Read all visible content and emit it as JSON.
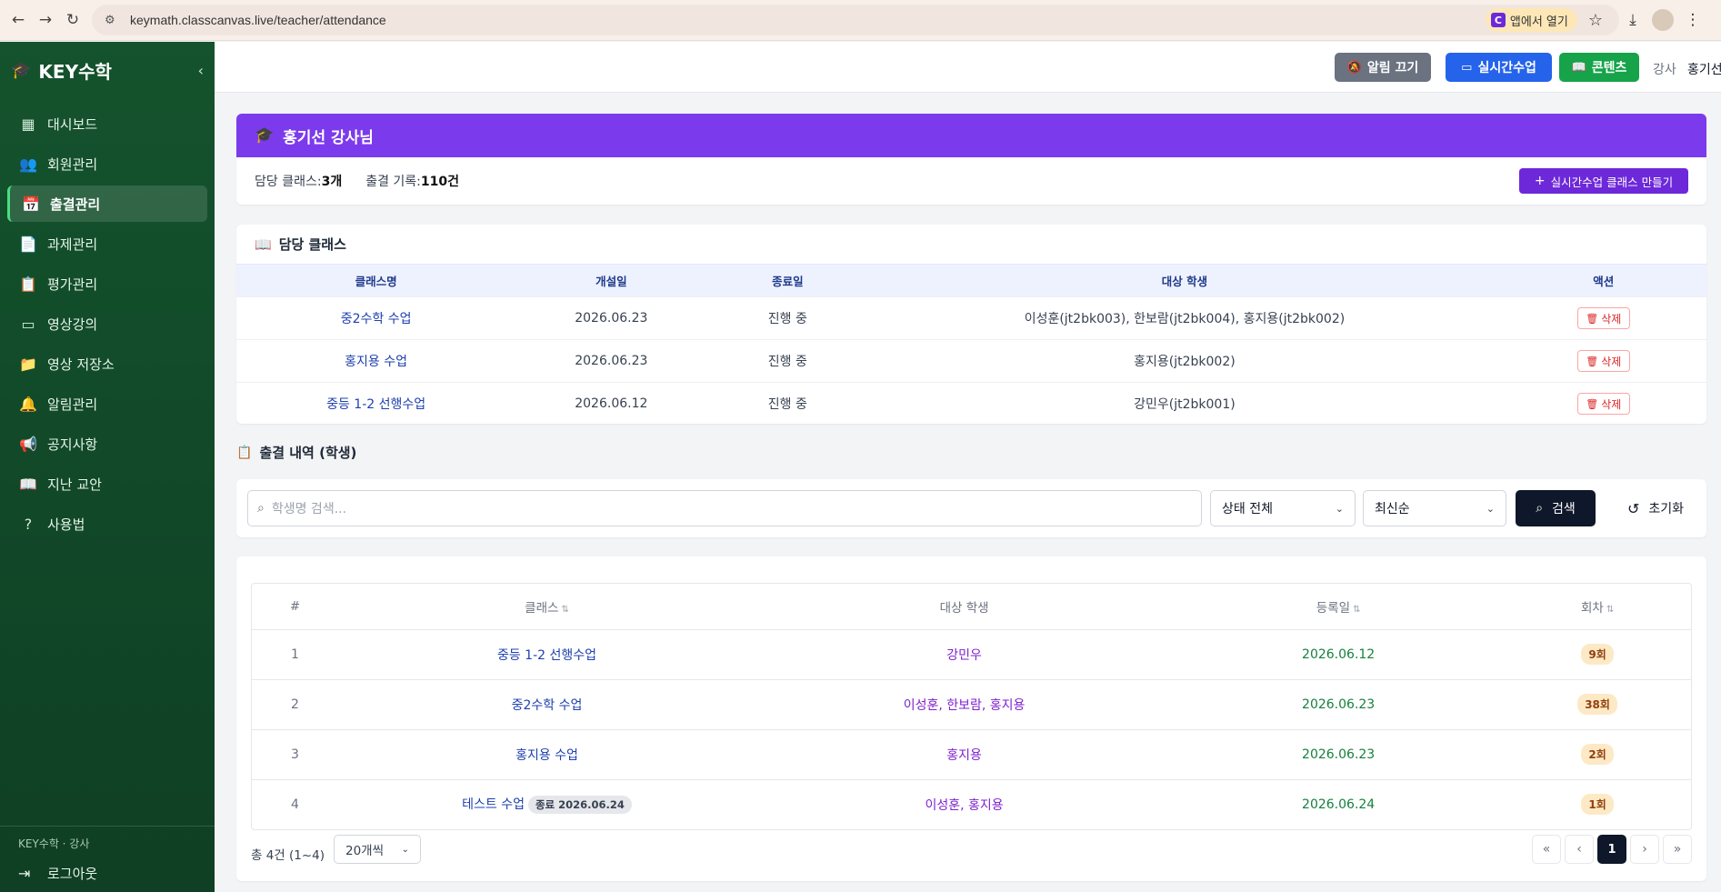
{
  "browser": {
    "url": "keymath.classcanvas.live/teacher/attendance",
    "open_app_label": "앱에서 열기",
    "open_app_icon": "C"
  },
  "sidebar": {
    "brand": "KEY수학",
    "items": [
      {
        "label": "대시보드",
        "icon": "dashboard-icon"
      },
      {
        "label": "회원관리",
        "icon": "users-icon"
      },
      {
        "label": "출결관리",
        "icon": "calendar-check-icon",
        "active": true
      },
      {
        "label": "과제관리",
        "icon": "document-icon"
      },
      {
        "label": "평가관리",
        "icon": "clipboard-icon"
      },
      {
        "label": "영상강의",
        "icon": "video-icon"
      },
      {
        "label": "영상 저장소",
        "icon": "folder-icon"
      },
      {
        "label": "알림관리",
        "icon": "bell-icon"
      },
      {
        "label": "공지사항",
        "icon": "megaphone-icon"
      },
      {
        "label": "지난 교안",
        "icon": "book-icon"
      },
      {
        "label": "사용법",
        "icon": "help-icon"
      }
    ],
    "footer_role": "KEY수학 · 강사",
    "logout_label": "로그아웃"
  },
  "topbar": {
    "mute_label": "알림 끄기",
    "live_label": "실시간수업",
    "content_label": "콘텐츠",
    "role": "강사",
    "name": "홍기선"
  },
  "instructor": {
    "title": "홍기선 강사님",
    "classes_label": "담당 클래스: ",
    "classes_value": "3개",
    "records_label": "출결 기록: ",
    "records_value": "110건",
    "make_class_label": "실시간수업 클래스 만들기"
  },
  "class_section": {
    "title": "담당 클래스",
    "headers": [
      "클래스명",
      "개설일",
      "종료일",
      "대상 학생",
      "액션"
    ],
    "rows": [
      {
        "name": "중2수학 수업",
        "opened": "2026.06.23",
        "ended": "진행 중",
        "students": "이성훈(jt2bk003), 한보람(jt2bk004), 홍지용(jt2bk002)",
        "action": "삭제"
      },
      {
        "name": "홍지용 수업",
        "opened": "2026.06.23",
        "ended": "진행 중",
        "students": "홍지용(jt2bk002)",
        "action": "삭제"
      },
      {
        "name": "중등 1-2 선행수업",
        "opened": "2026.06.12",
        "ended": "진행 중",
        "students": "강민우(jt2bk001)",
        "action": "삭제"
      }
    ]
  },
  "attendance": {
    "title": "출결 내역 (학생)",
    "search_placeholder": "학생명 검색...",
    "status_filter": "상태 전체",
    "sort_filter": "최신순",
    "search_label": "검색",
    "reset_label": "초기화",
    "headers": [
      "#",
      "클래스",
      "대상 학생",
      "등록일",
      "회차"
    ],
    "rows": [
      {
        "no": "1",
        "cls": "중등 1-2 선행수업",
        "badge": "",
        "students": "강민우",
        "date": "2026.06.12",
        "round": "9회"
      },
      {
        "no": "2",
        "cls": "중2수학 수업",
        "badge": "",
        "students": "이성훈, 한보람, 홍지용",
        "date": "2026.06.23",
        "round": "38회"
      },
      {
        "no": "3",
        "cls": "홍지용 수업",
        "badge": "",
        "students": "홍지용",
        "date": "2026.06.23",
        "round": "2회"
      },
      {
        "no": "4",
        "cls": "테스트 수업",
        "badge": "종료 2026.06.24",
        "students": "이성훈, 홍지용",
        "date": "2026.06.24",
        "round": "1회"
      }
    ],
    "total_info": "총 4건 (1~4)",
    "per_page": "20개씩",
    "current_page": "1"
  }
}
